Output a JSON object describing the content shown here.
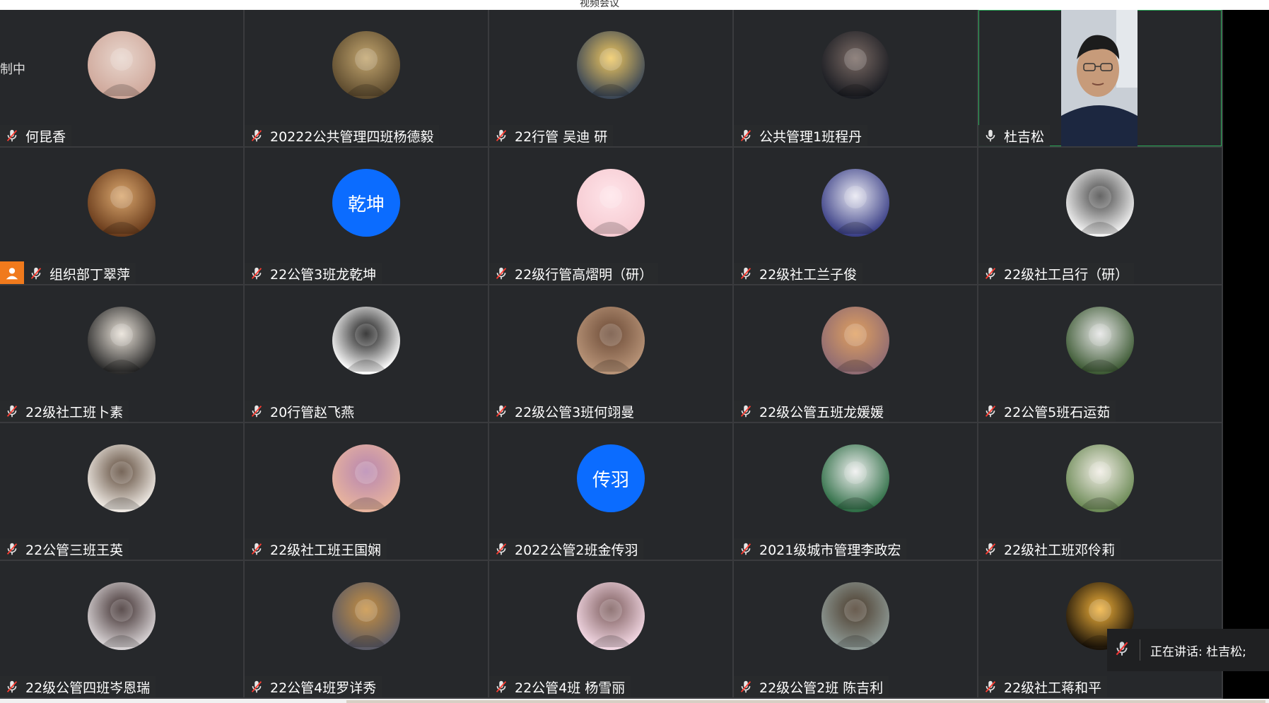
{
  "window": {
    "title": "视频会议"
  },
  "tiles": [
    {
      "name": "何昆香",
      "avatar": "photo",
      "colors": [
        "#cfa89b",
        "#e8d6cd"
      ],
      "cut": "制中"
    },
    {
      "name": "20222公共管理四班杨德毅",
      "avatar": "photo",
      "colors": [
        "#5c4a2e",
        "#c2a56e"
      ]
    },
    {
      "name": "22行管 吴迪 研",
      "avatar": "photo",
      "colors": [
        "#3a4656",
        "#f0c860"
      ]
    },
    {
      "name": "公共管理1班程丹",
      "avatar": "photo",
      "colors": [
        "#1a1c22",
        "#7a6a64"
      ]
    },
    {
      "name": "杜吉松",
      "avatar": "video",
      "colors": [
        "#c9cfd6",
        "#1c2740"
      ]
    },
    {
      "name": "组织部丁翠萍",
      "avatar": "photo",
      "colors": [
        "#6a3c1c",
        "#d9a66d"
      ],
      "host": true
    },
    {
      "name": "22公管3班龙乾坤",
      "avatar": "text",
      "text": "乾坤"
    },
    {
      "name": "22级行管高熠明（研）",
      "avatar": "photo",
      "colors": [
        "#f6cbd2",
        "#ffe5ea"
      ]
    },
    {
      "name": "22级社工兰子俊",
      "avatar": "photo",
      "colors": [
        "#3a3f86",
        "#e8e8f2"
      ]
    },
    {
      "name": "22级社工吕行（研）",
      "avatar": "photo",
      "colors": [
        "#f2f2f2",
        "#444"
      ]
    },
    {
      "name": "22级社工班卜素",
      "avatar": "photo",
      "colors": [
        "#2a2a2a",
        "#e9e2d8"
      ]
    },
    {
      "name": "20行管赵飞燕",
      "avatar": "photo",
      "colors": [
        "#ffffff",
        "#111"
      ]
    },
    {
      "name": "22级公管3班何翊曼",
      "avatar": "photo",
      "colors": [
        "#b89478",
        "#6b4a36"
      ]
    },
    {
      "name": "22级公管五班龙媛媛",
      "avatar": "photo",
      "colors": [
        "#8f6b73",
        "#e0a060"
      ]
    },
    {
      "name": "22公管5班石运茹",
      "avatar": "photo",
      "colors": [
        "#3d5a34",
        "#e6e6e6"
      ]
    },
    {
      "name": "22公管三班王英",
      "avatar": "photo",
      "colors": [
        "#efeae4",
        "#5a4636"
      ]
    },
    {
      "name": "22级社工班王国娴",
      "avatar": "photo",
      "colors": [
        "#e8b49d",
        "#b685b0"
      ]
    },
    {
      "name": "2022公管2班金传羽",
      "avatar": "text",
      "text": "传羽"
    },
    {
      "name": "2021级城市管理李政宏",
      "avatar": "photo",
      "colors": [
        "#2f6e46",
        "#f0f0f0"
      ]
    },
    {
      "name": "22级社工班邓伶莉",
      "avatar": "photo",
      "colors": [
        "#6c8a56",
        "#f2eee6"
      ]
    },
    {
      "name": "22级公管四班岑恩瑞",
      "avatar": "photo",
      "colors": [
        "#d9d4d6",
        "#3a2a2a"
      ]
    },
    {
      "name": "22公管4班罗详秀",
      "avatar": "photo",
      "colors": [
        "#5a5a66",
        "#c89040"
      ]
    },
    {
      "name": "22公管4班 杨雪丽",
      "avatar": "photo",
      "colors": [
        "#f3d8e4",
        "#7a5a5a"
      ]
    },
    {
      "name": "22级公管2班 陈吉利",
      "avatar": "photo",
      "colors": [
        "#8e9a96",
        "#4a3a2a"
      ]
    },
    {
      "name": "22级社工蒋和平",
      "avatar": "photo",
      "colors": [
        "#1a1208",
        "#f2b23a"
      ]
    }
  ],
  "speaking": {
    "label": "正在讲话: 杜吉松;"
  }
}
